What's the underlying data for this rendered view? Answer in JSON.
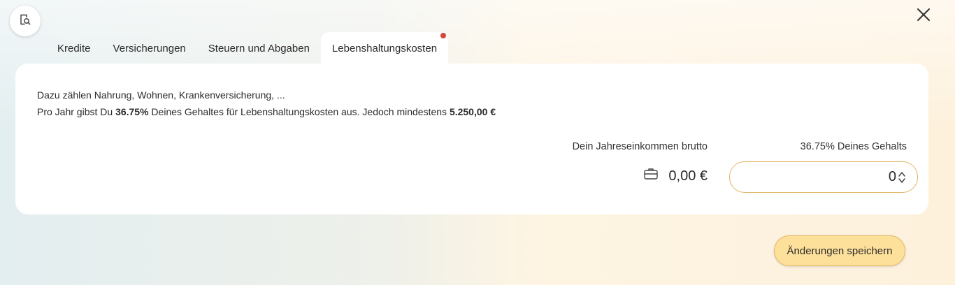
{
  "tabs": [
    {
      "label": "Kredite",
      "active": false
    },
    {
      "label": "Versicherungen",
      "active": false
    },
    {
      "label": "Steuern und Abgaben",
      "active": false
    },
    {
      "label": "Lebenshaltungskosten",
      "active": true,
      "notification": true
    }
  ],
  "description": {
    "line1": "Dazu zählen Nahrung, Wohnen, Krankenversicherung, ...",
    "line2_prefix": "Pro Jahr gibst Du ",
    "line2_percent": "36.75%",
    "line2_middle": " Deines Gehaltes für Lebenshaltungskosten aus. Jedoch mindestens ",
    "line2_minimum": "5.250,00 €"
  },
  "income": {
    "label": "Dein Jahreseinkommen brutto",
    "value": "0,00 €",
    "icon": "briefcase-icon"
  },
  "percentage": {
    "label": "36.75% Deines Gehalts",
    "input_value": "0"
  },
  "actions": {
    "save_label": "Änderungen speichern"
  },
  "icons": {
    "preview": "document-search-icon",
    "close": "close-icon"
  },
  "colors": {
    "save_button_bg": "#fde09a",
    "save_button_border": "#e5b865",
    "input_border": "#e2b464",
    "notification_dot": "#d9453d"
  }
}
